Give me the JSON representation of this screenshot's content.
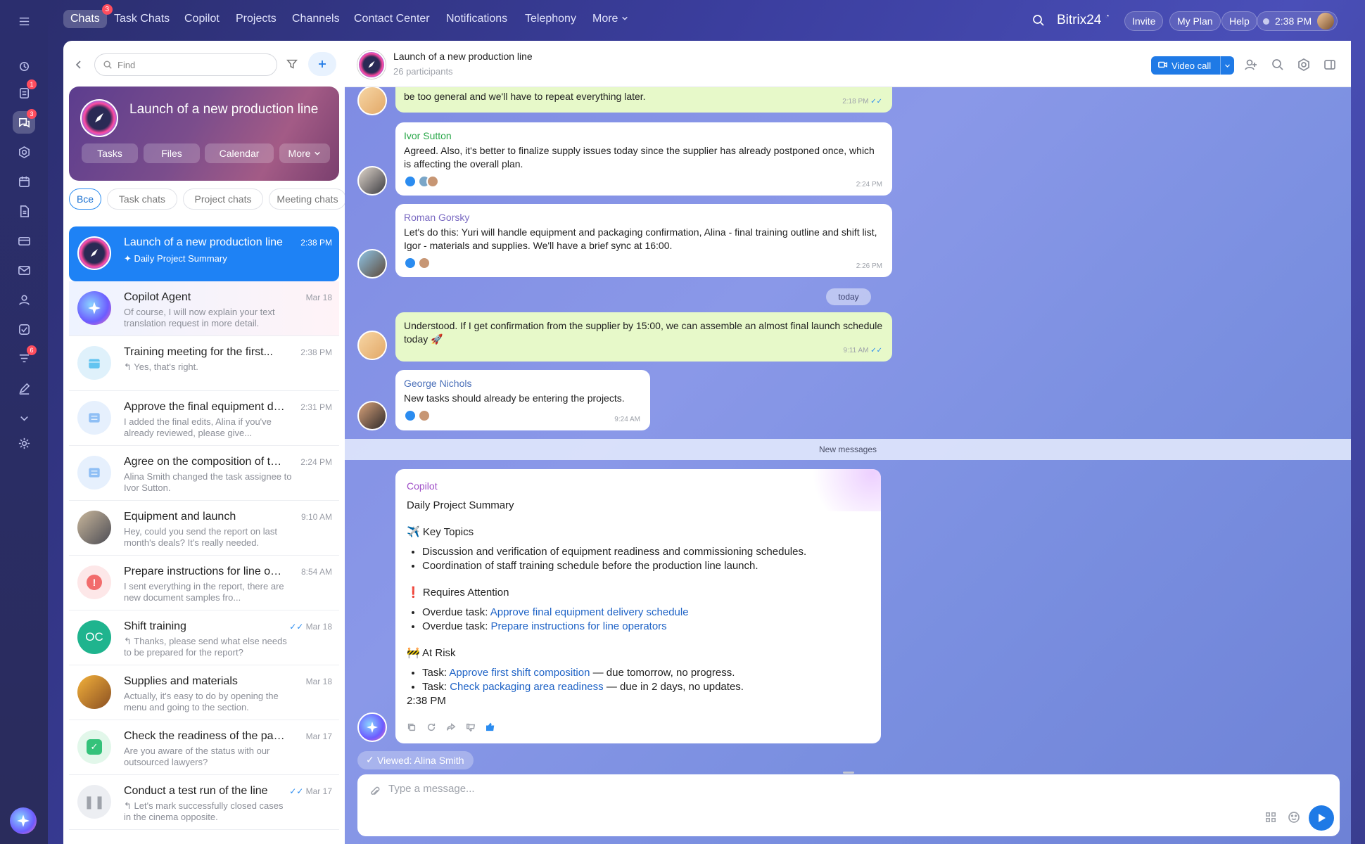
{
  "topbar": {
    "nav": [
      {
        "label": "Chats",
        "badge": "3"
      },
      {
        "label": "Task Chats"
      },
      {
        "label": "Copilot"
      },
      {
        "label": "Projects"
      },
      {
        "label": "Channels"
      },
      {
        "label": "Contact Center"
      },
      {
        "label": "Notifications"
      },
      {
        "label": "Telephony"
      },
      {
        "label": "More"
      }
    ],
    "brand": "Bitrix24",
    "invite": "Invite",
    "my_plan": "My Plan",
    "help": "Help",
    "clock": "2:38 PM"
  },
  "rail": {
    "badges": {
      "tasks": "1",
      "chats": "3",
      "funnel": "6"
    }
  },
  "sidebar": {
    "search_placeholder": "Find",
    "hero": {
      "title": "Launch of a new production line",
      "buttons": [
        "Tasks",
        "Files",
        "Calendar",
        "More"
      ]
    },
    "filters": [
      "Все",
      "Task chats",
      "Project chats",
      "Meeting chats"
    ],
    "chats": [
      {
        "name": "Launch of a new production line",
        "time": "2:38 PM",
        "preview": "Daily Project Summary"
      },
      {
        "name": "Copilot Agent",
        "time": "Mar 18",
        "preview": "Of course, I will now explain your text translation request in more detail."
      },
      {
        "name": "Training meeting for the first...",
        "time": "2:38 PM",
        "preview": "Yes, that's right."
      },
      {
        "name": "Approve the final equipment del...",
        "time": "2:31 PM",
        "preview": "I added the final edits, Alina if you've already reviewed, please give..."
      },
      {
        "name": "Agree on the composition of the...",
        "time": "2:24 PM",
        "preview": "Alina Smith changed the task assignee to Ivor Sutton."
      },
      {
        "name": "Equipment and launch",
        "time": "9:10 AM",
        "preview": "Hey, could you send the report on last month's deals? It's really needed."
      },
      {
        "name": "Prepare instructions for line ope...",
        "time": "8:54 AM",
        "preview": "I sent everything in the report, there are new document samples fro..."
      },
      {
        "name": "Shift training",
        "time": "Mar 18",
        "preview": "Thanks, please send what else needs to be prepared for the report?",
        "initials": "OC"
      },
      {
        "name": "Supplies and materials",
        "time": "Mar 18",
        "preview": "Actually, it's easy to do by opening the menu and going to the section."
      },
      {
        "name": "Check the readiness of the packa...",
        "time": "Mar 17",
        "preview": "Are you aware of the status with our outsourced lawyers?"
      },
      {
        "name": "Conduct a test run of the line",
        "time": "Mar 17",
        "preview": "Let's mark successfully closed cases in the cinema opposite."
      }
    ]
  },
  "header": {
    "title": "Launch of a new production line",
    "participants": "26 participants",
    "video_call": "Video call"
  },
  "messages": [
    {
      "author": "",
      "text": "be too general and we'll have to repeat everything later.",
      "time": "2:18 PM"
    },
    {
      "author": "Ivor Sutton",
      "text": "Agreed. Also, it's better to finalize supply issues today since the supplier has already postponed once, which is affecting the overall plan.",
      "time": "2:24 PM"
    },
    {
      "author": "Roman Gorsky",
      "text": "Let's do this: Yuri will handle equipment and packaging confirmation, Alina - final training outline and shift list, Igor - materials and supplies. We'll have a brief sync at 16:00.",
      "time": "2:26 PM"
    },
    {
      "author": "",
      "text": "Understood. If I get confirmation from the supplier by 15:00, we can assemble an almost final launch schedule today 🚀",
      "time": "9:11 AM"
    },
    {
      "author": "George Nichols",
      "text": "New tasks should already be entering the projects.",
      "time": "9:24 AM"
    }
  ],
  "date_divider": "today",
  "new_messages": "New messages",
  "copilot": {
    "author": "Copilot",
    "title": "Daily Project Summary",
    "key_topics_title": "Key Topics",
    "key_topics": [
      "Discussion and verification of equipment readiness and commissioning schedules.",
      "Coordination of staff training schedule before the production line launch."
    ],
    "attention_title": "Requires Attention",
    "overdue_prefix": "Overdue task: ",
    "attention": [
      "Approve final equipment delivery schedule",
      "Prepare instructions for line operators"
    ],
    "risk_title": "At Risk",
    "task_prefix": "Task: ",
    "risks": [
      {
        "task": "Approve first shift composition",
        "note": " — due tomorrow, no progress."
      },
      {
        "task": "Check packaging area readiness",
        "note": " — due in 2 days, no updates."
      }
    ],
    "time": "2:38 PM"
  },
  "viewed": "Viewed: Alina Smith",
  "composer": {
    "placeholder": "Type a message..."
  }
}
